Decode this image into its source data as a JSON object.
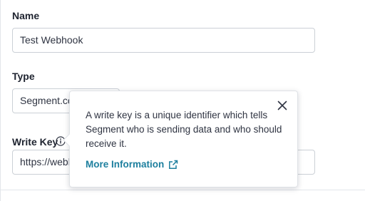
{
  "form": {
    "name_label": "Name",
    "name_value": "Test Webhook",
    "type_label": "Type",
    "type_value": "Segment.com",
    "write_key_label": "Write Key",
    "write_key_value": "https://webhook"
  },
  "popover": {
    "text": "A write key is a unique identifier which tells Segment who is sending data and who should receive it.",
    "link_label": "More Information",
    "link_icon": "external-link-icon",
    "close_icon": "close-icon"
  },
  "colors": {
    "link": "#1d7f9e",
    "label": "#1f2430",
    "border": "#cbd0d6"
  }
}
